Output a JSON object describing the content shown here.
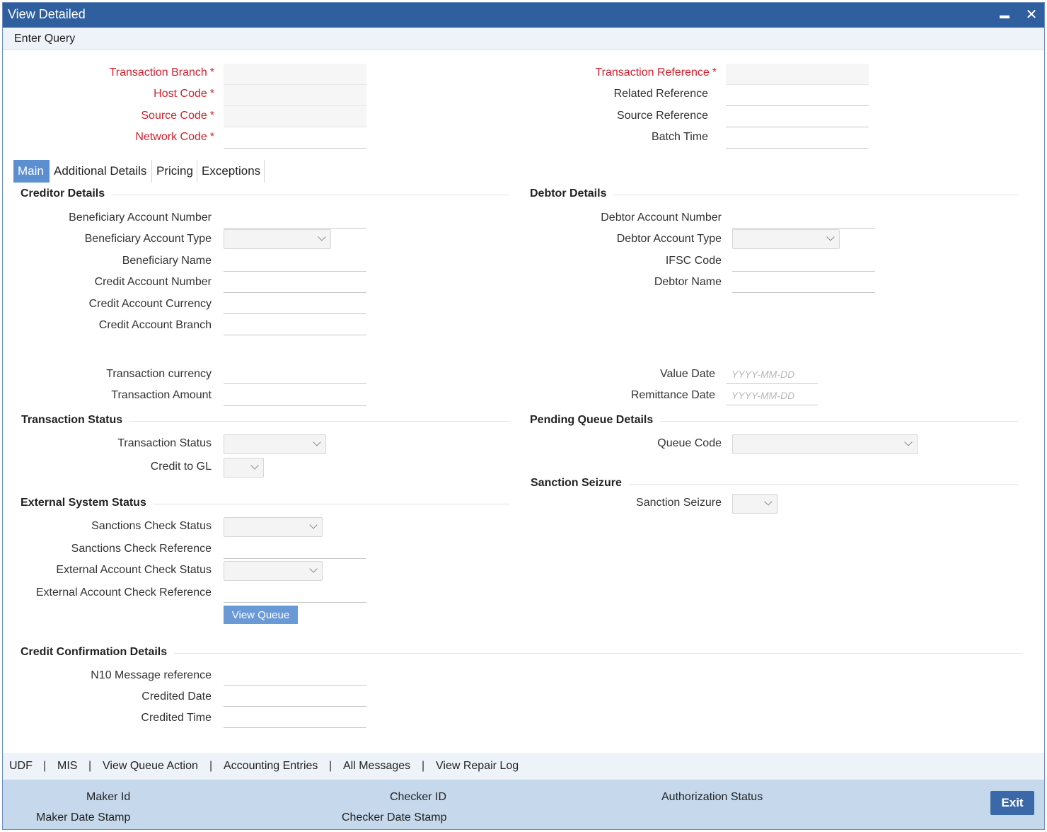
{
  "window": {
    "title": "View Detailed",
    "minimize_glyph": "▬",
    "close_glyph": "✕"
  },
  "menu": {
    "enter_query": "Enter Query"
  },
  "header": {
    "transaction_branch": "Transaction Branch",
    "host_code": "Host Code",
    "source_code": "Source Code",
    "network_code": "Network Code",
    "transaction_reference": "Transaction Reference",
    "related_reference": "Related Reference",
    "source_reference": "Source Reference",
    "batch_time": "Batch Time",
    "required_mark": "*"
  },
  "tabs": [
    "Main",
    "Additional Details",
    "Pricing",
    "Exceptions"
  ],
  "creditor": {
    "section": "Creditor Details",
    "beneficiary_account_number": "Beneficiary Account Number",
    "beneficiary_account_type": "Beneficiary Account Type",
    "beneficiary_name": "Beneficiary Name",
    "credit_account_number": "Credit Account Number",
    "credit_account_currency": "Credit Account Currency",
    "credit_account_branch": "Credit Account Branch",
    "transaction_currency": "Transaction currency",
    "transaction_amount": "Transaction Amount"
  },
  "debtor": {
    "section": "Debtor Details",
    "debtor_account_number": "Debtor Account Number",
    "debtor_account_type": "Debtor Account Type",
    "ifsc_code": "IFSC Code",
    "debtor_name": "Debtor Name",
    "value_date": "Value Date",
    "remittance_date": "Remittance Date",
    "date_placeholder": "YYYY-MM-DD"
  },
  "transaction_status": {
    "section": "Transaction Status",
    "status_label": "Transaction Status",
    "credit_to_gl": "Credit to GL"
  },
  "pending_queue": {
    "section": "Pending Queue Details",
    "queue_code": "Queue Code"
  },
  "sanction": {
    "section": "Sanction Seizure",
    "label": "Sanction Seizure"
  },
  "external": {
    "section": "External System Status",
    "sanctions_check_status": "Sanctions Check Status",
    "sanctions_check_reference": "Sanctions Check Reference",
    "external_account_check_status": "External Account Check Status",
    "external_account_check_reference": "External Account Check Reference",
    "view_queue": "View Queue"
  },
  "credit_confirmation": {
    "section": "Credit Confirmation Details",
    "n10_message_reference": "N10 Message reference",
    "credited_date": "Credited Date",
    "credited_time": "Credited Time"
  },
  "footer_links": [
    "UDF",
    "MIS",
    "View Queue Action",
    "Accounting Entries",
    "All Messages",
    "View Repair Log"
  ],
  "footer_separator": "|",
  "audit": {
    "maker_id": "Maker Id",
    "maker_date_stamp": "Maker Date Stamp",
    "checker_id": "Checker ID",
    "checker_date_stamp": "Checker Date Stamp",
    "authorization_status": "Authorization Status",
    "exit": "Exit"
  }
}
